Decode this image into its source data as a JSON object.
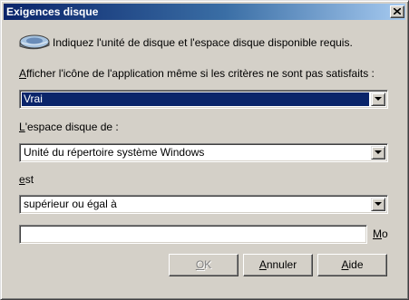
{
  "window": {
    "title": "Exigences disque"
  },
  "intro": {
    "text": "Indiquez l'unité de disque et l'espace disque disponible requis."
  },
  "show_icon": {
    "label_prefix": "A",
    "label_rest": "fficher l'icône de l'application même si les critères ne sont pas satisfaits :",
    "value": "Vrai"
  },
  "disk_space": {
    "label_prefix": "L",
    "label_rest": "'espace disque de :",
    "value": "Unité du répertoire système Windows"
  },
  "comparison": {
    "label_prefix": "e",
    "label_rest": "st",
    "value": "supérieur ou égal à"
  },
  "size": {
    "value": "",
    "unit_prefix": "M",
    "unit_rest": "o"
  },
  "buttons": {
    "ok": {
      "prefix": "O",
      "rest": "K"
    },
    "cancel": {
      "prefix": "A",
      "rest": "nnuler"
    },
    "help": {
      "prefix": "A",
      "rest": "ide"
    }
  }
}
